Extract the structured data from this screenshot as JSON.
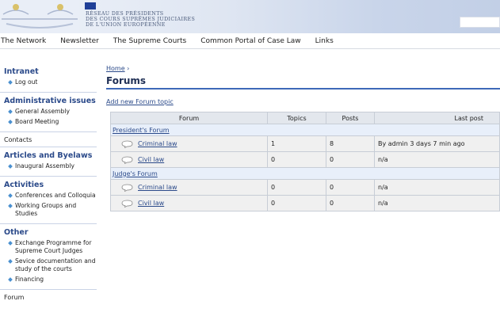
{
  "header": {
    "org_lines": [
      "RÉSEAU DES PRÉSIDENTS",
      "DES COURS SUPRÊMES JUDICIAIRES",
      "DE L'UNION EUROPÉENNE"
    ]
  },
  "topnav": {
    "items": [
      "The Network",
      "Newsletter",
      "The Supreme Courts",
      "Common Portal of Case Law",
      "Links"
    ]
  },
  "sidebar": {
    "sections": [
      {
        "heading": "Intranet",
        "items": [
          "Log out"
        ]
      },
      {
        "heading": "Administrative issues",
        "items": [
          "General Assembly",
          "Board Meeting"
        ]
      },
      {
        "plain": "Contacts"
      },
      {
        "heading": "Articles and Byelaws",
        "items": [
          "Inaugural Assembly"
        ]
      },
      {
        "heading": "Activities",
        "items": [
          "Conferences and Colloquia",
          "Working Groups and Studies"
        ]
      },
      {
        "heading": "Other",
        "items": [
          "Exchange Programme for Supreme Court Judges",
          "Sevice documentation and study of the courts",
          "Financing"
        ]
      },
      {
        "plain": "Forum"
      }
    ]
  },
  "main": {
    "breadcrumb_home": "Home",
    "breadcrumb_sep": "›",
    "title": "Forums",
    "add_link": "Add new Forum topic",
    "columns": [
      "Forum",
      "Topics",
      "Posts",
      "Last post"
    ],
    "groups": [
      {
        "name": "President's Forum",
        "rows": [
          {
            "forum": "Criminal law",
            "topics": "1",
            "posts": "8",
            "last_post": "By admin 3 days 7 min ago"
          },
          {
            "forum": "Civil law",
            "topics": "0",
            "posts": "0",
            "last_post": "n/a"
          }
        ]
      },
      {
        "name": "Judge's Forum",
        "rows": [
          {
            "forum": "Criminal law",
            "topics": "0",
            "posts": "0",
            "last_post": "n/a"
          },
          {
            "forum": "Civil law",
            "topics": "0",
            "posts": "0",
            "last_post": "n/a"
          }
        ]
      }
    ]
  }
}
